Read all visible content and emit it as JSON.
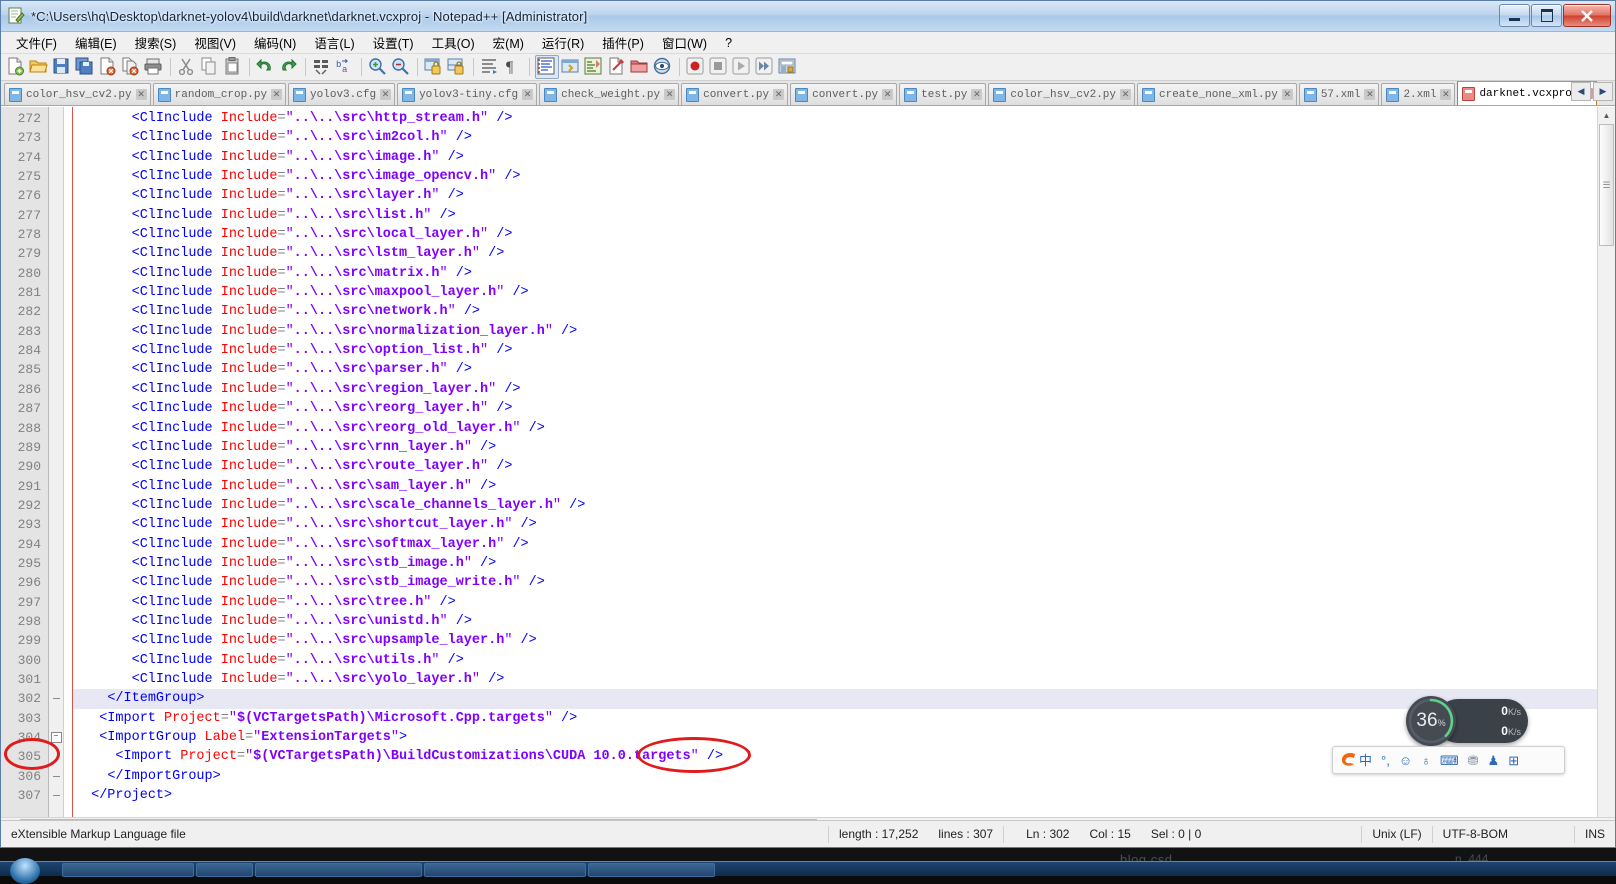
{
  "window": {
    "title": "*C:\\Users\\hq\\Desktop\\darknet-yolov4\\build\\darknet\\darknet.vcxproj - Notepad++ [Administrator]",
    "icon": "notepad-plus-plus-icon",
    "controls": {
      "minimize": "–",
      "maximize": "❐",
      "close": "✕"
    }
  },
  "menubar": {
    "items": [
      {
        "label": "文件(F)",
        "name": "menu-file"
      },
      {
        "label": "编辑(E)",
        "name": "menu-edit"
      },
      {
        "label": "搜索(S)",
        "name": "menu-search"
      },
      {
        "label": "视图(V)",
        "name": "menu-view"
      },
      {
        "label": "编码(N)",
        "name": "menu-encoding"
      },
      {
        "label": "语言(L)",
        "name": "menu-language"
      },
      {
        "label": "设置(T)",
        "name": "menu-settings"
      },
      {
        "label": "工具(O)",
        "name": "menu-tools"
      },
      {
        "label": "宏(M)",
        "name": "menu-macro"
      },
      {
        "label": "运行(R)",
        "name": "menu-run"
      },
      {
        "label": "插件(P)",
        "name": "menu-plugins"
      },
      {
        "label": "窗口(W)",
        "name": "menu-window"
      },
      {
        "label": "?",
        "name": "menu-help"
      }
    ]
  },
  "toolbar": {
    "icons": [
      "new-file-icon",
      "open-file-icon",
      "save-icon",
      "save-all-icon",
      "close-file-icon",
      "close-all-icon",
      "print-icon",
      "sep",
      "cut-icon",
      "copy-icon",
      "paste-icon",
      "sep",
      "undo-icon",
      "redo-icon",
      "sep",
      "find-icon",
      "replace-icon",
      "sep",
      "zoom-in-icon",
      "zoom-out-icon",
      "sep",
      "sync-vertical-icon",
      "sync-horizontal-icon",
      "sep",
      "word-wrap-icon",
      "show-all-chars-icon",
      "sep",
      "indent-guide-icon",
      "ui-settings-icon",
      "show-map-icon",
      "document-switcher-icon",
      "folder-as-workspace-icon",
      "monitoring-icon",
      "sep",
      "record-macro-icon",
      "stop-macro-icon",
      "play-macro-icon",
      "playback-multiple-icon",
      "save-macro-icon"
    ]
  },
  "tabs": [
    {
      "label": "color_hsv_cv2.py",
      "active": false,
      "modified": false
    },
    {
      "label": "random_crop.py",
      "active": false,
      "modified": false
    },
    {
      "label": "yolov3.cfg",
      "active": false,
      "modified": false
    },
    {
      "label": "yolov3-tiny.cfg",
      "active": false,
      "modified": false
    },
    {
      "label": "check_weight.py",
      "active": false,
      "modified": false
    },
    {
      "label": "convert.py",
      "active": false,
      "modified": false
    },
    {
      "label": "convert.py",
      "active": false,
      "modified": false
    },
    {
      "label": "test.py",
      "active": false,
      "modified": false
    },
    {
      "label": "color_hsv_cv2.py",
      "active": false,
      "modified": false
    },
    {
      "label": "create_none_xml.py",
      "active": false,
      "modified": false
    },
    {
      "label": "57.xml",
      "active": false,
      "modified": false
    },
    {
      "label": "2.xml",
      "active": false,
      "modified": false
    },
    {
      "label": "darknet.vcxproj",
      "active": true,
      "modified": true
    }
  ],
  "tab_scroll": {
    "left": "◀",
    "right": "▶"
  },
  "editor": {
    "first_line": 272,
    "current_line_index": 30,
    "lines": [
      {
        "n": 272,
        "indent": 6,
        "tag": "ClInclude",
        "attr": "Include",
        "value": "..\\..\\src\\http_stream.h"
      },
      {
        "n": 273,
        "indent": 6,
        "tag": "ClInclude",
        "attr": "Include",
        "value": "..\\..\\src\\im2col.h"
      },
      {
        "n": 274,
        "indent": 6,
        "tag": "ClInclude",
        "attr": "Include",
        "value": "..\\..\\src\\image.h"
      },
      {
        "n": 275,
        "indent": 6,
        "tag": "ClInclude",
        "attr": "Include",
        "value": "..\\..\\src\\image_opencv.h"
      },
      {
        "n": 276,
        "indent": 6,
        "tag": "ClInclude",
        "attr": "Include",
        "value": "..\\..\\src\\layer.h"
      },
      {
        "n": 277,
        "indent": 6,
        "tag": "ClInclude",
        "attr": "Include",
        "value": "..\\..\\src\\list.h"
      },
      {
        "n": 278,
        "indent": 6,
        "tag": "ClInclude",
        "attr": "Include",
        "value": "..\\..\\src\\local_layer.h"
      },
      {
        "n": 279,
        "indent": 6,
        "tag": "ClInclude",
        "attr": "Include",
        "value": "..\\..\\src\\lstm_layer.h"
      },
      {
        "n": 280,
        "indent": 6,
        "tag": "ClInclude",
        "attr": "Include",
        "value": "..\\..\\src\\matrix.h"
      },
      {
        "n": 281,
        "indent": 6,
        "tag": "ClInclude",
        "attr": "Include",
        "value": "..\\..\\src\\maxpool_layer.h"
      },
      {
        "n": 282,
        "indent": 6,
        "tag": "ClInclude",
        "attr": "Include",
        "value": "..\\..\\src\\network.h"
      },
      {
        "n": 283,
        "indent": 6,
        "tag": "ClInclude",
        "attr": "Include",
        "value": "..\\..\\src\\normalization_layer.h"
      },
      {
        "n": 284,
        "indent": 6,
        "tag": "ClInclude",
        "attr": "Include",
        "value": "..\\..\\src\\option_list.h"
      },
      {
        "n": 285,
        "indent": 6,
        "tag": "ClInclude",
        "attr": "Include",
        "value": "..\\..\\src\\parser.h"
      },
      {
        "n": 286,
        "indent": 6,
        "tag": "ClInclude",
        "attr": "Include",
        "value": "..\\..\\src\\region_layer.h"
      },
      {
        "n": 287,
        "indent": 6,
        "tag": "ClInclude",
        "attr": "Include",
        "value": "..\\..\\src\\reorg_layer.h"
      },
      {
        "n": 288,
        "indent": 6,
        "tag": "ClInclude",
        "attr": "Include",
        "value": "..\\..\\src\\reorg_old_layer.h"
      },
      {
        "n": 289,
        "indent": 6,
        "tag": "ClInclude",
        "attr": "Include",
        "value": "..\\..\\src\\rnn_layer.h"
      },
      {
        "n": 290,
        "indent": 6,
        "tag": "ClInclude",
        "attr": "Include",
        "value": "..\\..\\src\\route_layer.h"
      },
      {
        "n": 291,
        "indent": 6,
        "tag": "ClInclude",
        "attr": "Include",
        "value": "..\\..\\src\\sam_layer.h"
      },
      {
        "n": 292,
        "indent": 6,
        "tag": "ClInclude",
        "attr": "Include",
        "value": "..\\..\\src\\scale_channels_layer.h"
      },
      {
        "n": 293,
        "indent": 6,
        "tag": "ClInclude",
        "attr": "Include",
        "value": "..\\..\\src\\shortcut_layer.h"
      },
      {
        "n": 294,
        "indent": 6,
        "tag": "ClInclude",
        "attr": "Include",
        "value": "..\\..\\src\\softmax_layer.h"
      },
      {
        "n": 295,
        "indent": 6,
        "tag": "ClInclude",
        "attr": "Include",
        "value": "..\\..\\src\\stb_image.h"
      },
      {
        "n": 296,
        "indent": 6,
        "tag": "ClInclude",
        "attr": "Include",
        "value": "..\\..\\src\\stb_image_write.h"
      },
      {
        "n": 297,
        "indent": 6,
        "tag": "ClInclude",
        "attr": "Include",
        "value": "..\\..\\src\\tree.h"
      },
      {
        "n": 298,
        "indent": 6,
        "tag": "ClInclude",
        "attr": "Include",
        "value": "..\\..\\src\\unistd.h"
      },
      {
        "n": 299,
        "indent": 6,
        "tag": "ClInclude",
        "attr": "Include",
        "value": "..\\..\\src\\upsample_layer.h"
      },
      {
        "n": 300,
        "indent": 6,
        "tag": "ClInclude",
        "attr": "Include",
        "value": "..\\..\\src\\utils.h"
      },
      {
        "n": 301,
        "indent": 6,
        "tag": "ClInclude",
        "attr": "Include",
        "value": "..\\..\\src\\yolo_layer.h"
      },
      {
        "n": 302,
        "indent": 3,
        "closing": "</ItemGroup>",
        "fold": "dash",
        "current": true
      },
      {
        "n": 303,
        "indent": 2,
        "tag": "Import",
        "attr": "Project",
        "value": "$(VCTargetsPath)\\Microsoft.Cpp.targets"
      },
      {
        "n": 304,
        "indent": 2,
        "tag": "ImportGroup",
        "attr": "Label",
        "value": "ExtensionTargets",
        "open_tag": true,
        "fold": "box"
      },
      {
        "n": 305,
        "indent": 4,
        "tag": "Import",
        "attr": "Project",
        "value": "$(VCTargetsPath)\\BuildCustomizations\\CUDA 10.0.targets"
      },
      {
        "n": 306,
        "indent": 3,
        "closing": "</ImportGroup>",
        "fold": "dash"
      },
      {
        "n": 307,
        "indent": 1,
        "closing": "</Project>",
        "fold": "dash"
      }
    ]
  },
  "annotations": [
    {
      "name": "annot-line-number-305",
      "target": "line number 305",
      "color": "#e01b1b"
    },
    {
      "name": "annot-cuda-version",
      "target": "CUDA 10.0",
      "color": "#e01b1b"
    }
  ],
  "statusbar": {
    "filetype": "eXtensible Markup Language file",
    "length_label": "length : 17,252",
    "lines_label": "lines : 307",
    "ln": "Ln : 302",
    "col": "Col : 15",
    "sel": "Sel : 0 | 0",
    "eol": "Unix (LF)",
    "encoding": "UTF-8-BOM",
    "mode": "INS"
  },
  "net_widget": {
    "cpu_percent": "36",
    "cpu_percent_symbol": "%",
    "upload": "0",
    "download": "0",
    "unit": "K/s",
    "up_arrow": "↑",
    "down_arrow": "↓"
  },
  "ime_bar": {
    "logo": "sogou-logo-icon",
    "items": [
      {
        "name": "ime-chinese-mode-icon",
        "glyph": "中"
      },
      {
        "name": "ime-punctuation-icon",
        "glyph": "°,"
      },
      {
        "name": "ime-emoji-icon",
        "glyph": "☺"
      },
      {
        "name": "ime-voice-input-icon",
        "glyph": "♁"
      },
      {
        "name": "ime-soft-keyboard-icon",
        "glyph": "⌨"
      },
      {
        "name": "ime-user-icon",
        "glyph": "⛃"
      },
      {
        "name": "ime-skin-icon",
        "glyph": "♟"
      },
      {
        "name": "ime-toolbox-icon",
        "glyph": "⊞"
      }
    ]
  },
  "watermarks": {
    "blog": "blog.csd",
    "user": "n_444"
  }
}
